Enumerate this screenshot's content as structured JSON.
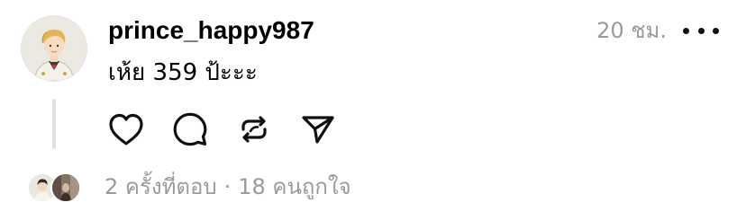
{
  "post": {
    "username": "prince_happy987",
    "timestamp": "20 ชม.",
    "text": "เห้ย 359 ป้ะะะ"
  },
  "footer": {
    "replies": "2 ครั้งที่ตอบ",
    "separator": "·",
    "likes": "18 คนถูกใจ"
  },
  "icons": {
    "like": "heart-icon",
    "reply": "comment-bubble-icon",
    "repost": "repost-icon",
    "share": "send-icon",
    "more": "more-dots-icon"
  },
  "colors": {
    "text": "#000000",
    "secondary": "#9a9a9a",
    "thread_line": "#e2e2e2"
  }
}
